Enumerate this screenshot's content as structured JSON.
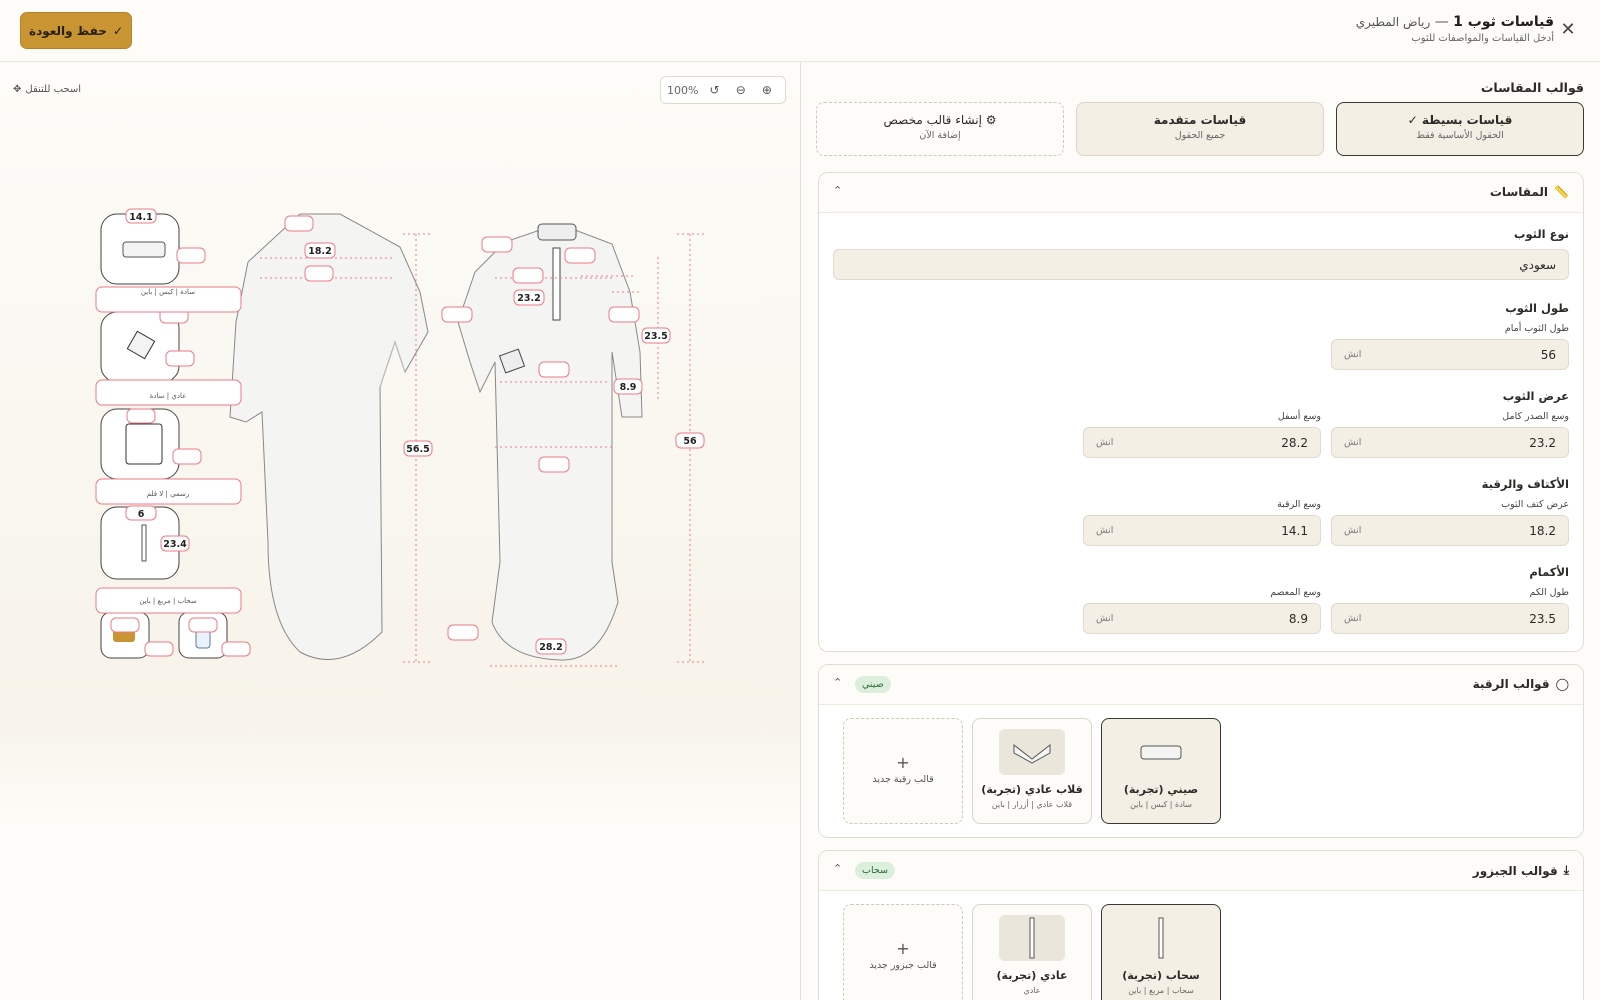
{
  "header": {
    "save_label": "حفظ والعودة",
    "title": "قياسات ثوب 1",
    "title_sep": " — ",
    "customer": "رياض المطيري",
    "subtitle": "أدخل القياسات والمواصفات للثوب"
  },
  "canvas": {
    "drag_hint": "اسحب للتنقل",
    "zoom": "100%",
    "back_labels": {
      "neck_width": "14.1",
      "shoulder": "18.2",
      "length_back": "56.5",
      "pocket": "6",
      "jabzoor": "23.4"
    },
    "front_labels": {
      "chest": "23.2",
      "sleeve": "23.5",
      "cuff": "8.9",
      "length_front": "56",
      "bottom": "28.2"
    },
    "style_labels": {
      "collar": "سادة | كبس | باين",
      "cuff": "عادي | سادة",
      "pocket": "رسمي | لا قلم",
      "jabzoor": "سحاب | مربع | باين"
    }
  },
  "templates": {
    "title": "قوالب المقاسات",
    "items": [
      {
        "name": "قياسات بسيطة",
        "check": "✓",
        "sub": "الحقول الأساسية فقط"
      },
      {
        "name": "قياسات متقدمة",
        "sub": "جميع الحقول"
      },
      {
        "name": "إنشاء قالب مخصص",
        "sub": "إضافة الآن"
      }
    ]
  },
  "measurements": {
    "title": "المقاسات",
    "thobe_type_label": "نوع الثوب",
    "thobe_type_value": "سعودي",
    "unit": "انش",
    "groups": {
      "length": {
        "title": "طول الثوب",
        "front_label": "طول الثوب أمام",
        "front_value": "56"
      },
      "width": {
        "title": "عرض الثوب",
        "chest_label": "وسع الصدر كامل",
        "chest_value": "23.2",
        "bottom_label": "وسع أسفل",
        "bottom_value": "28.2"
      },
      "shoulders": {
        "title": "الأكتاف والرقبة",
        "shoulder_label": "عرض كتف الثوب",
        "shoulder_value": "18.2",
        "neck_label": "وسع الرقبة",
        "neck_value": "14.1"
      },
      "sleeves": {
        "title": "الأكمام",
        "sleeve_label": "طول الكم",
        "sleeve_value": "23.5",
        "wrist_label": "وسع المعصم",
        "wrist_value": "8.9"
      }
    }
  },
  "collars": {
    "title": "قوالب الرقبة",
    "badge": "صيني",
    "items": [
      {
        "name": "صيني (تجربة)",
        "sub": "سادة | كبس | باين"
      },
      {
        "name": "قلاب عادي (تجربة)",
        "sub": "قلاب عادي | أزرار | باين"
      }
    ],
    "add_label": "قالب رقبة جديد"
  },
  "jabzoor": {
    "title": "قوالب الجبزور",
    "badge": "سحاب",
    "items": [
      {
        "name": "سحاب (تجربة)",
        "sub": "سحاب | مربع | باين"
      },
      {
        "name": "عادي (تجربة)",
        "sub": "عادي"
      }
    ],
    "add_label": "قالب جبزور جديد"
  },
  "colors": {
    "accent": "#c99432",
    "measure_line": "#ef7a85",
    "badge_bg": "#dcefdc"
  }
}
